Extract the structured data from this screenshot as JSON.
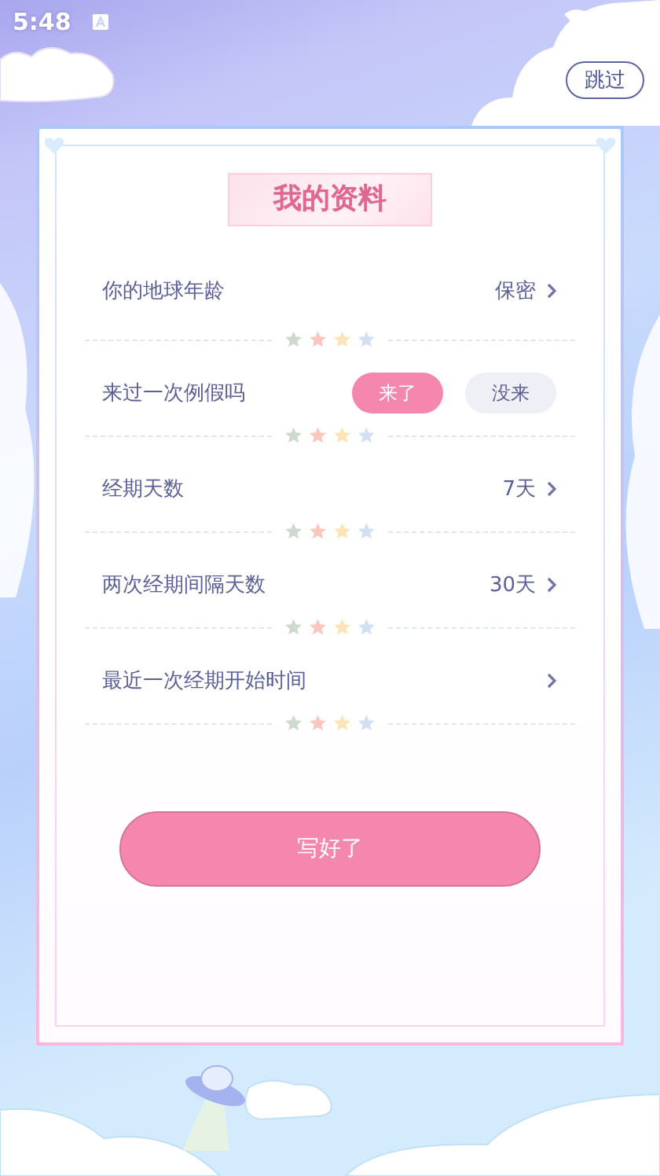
{
  "status_bar": {
    "time": "5:48"
  },
  "skip_button": {
    "label": "跳过"
  },
  "title": "我的资料",
  "rows": [
    {
      "kind": "value",
      "label": "你的地球年龄",
      "value": "保密"
    },
    {
      "kind": "choice",
      "label": "来过一次例假吗",
      "options": [
        {
          "label": "来了",
          "selected": true
        },
        {
          "label": "没来",
          "selected": false
        }
      ]
    },
    {
      "kind": "value",
      "label": "经期天数",
      "value": "7天"
    },
    {
      "kind": "value",
      "label": "两次经期间隔天数",
      "value": "30天"
    },
    {
      "kind": "value",
      "label": "最近一次经期开始时间"
    }
  ],
  "submit_button": {
    "label": "写好了"
  }
}
